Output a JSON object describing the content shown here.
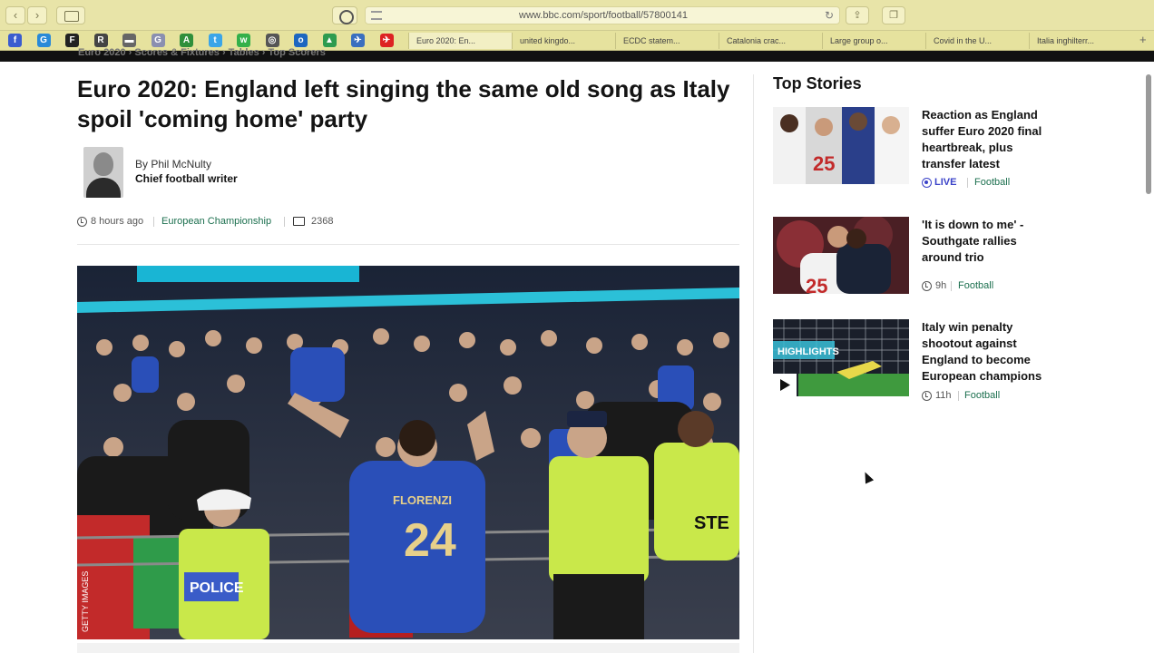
{
  "browser": {
    "url": "www.bbc.com/sport/football/57800141",
    "back_label": "‹",
    "forward_label": "›",
    "bookmarks": [
      {
        "name": "facebook",
        "glyph": "f",
        "color": "#3b5ccf"
      },
      {
        "name": "g",
        "glyph": "G",
        "color": "#2a8ad8"
      },
      {
        "name": "f-bold",
        "glyph": "F",
        "color": "#222222"
      },
      {
        "name": "r",
        "glyph": "R",
        "color": "#444444"
      },
      {
        "name": "bar",
        "glyph": "▬",
        "color": "#666666"
      },
      {
        "name": "g2",
        "glyph": "G",
        "color": "#8a8fb0"
      },
      {
        "name": "a",
        "glyph": "A",
        "color": "#2f8f3b"
      },
      {
        "name": "twitter",
        "glyph": "t",
        "color": "#3ba5e8"
      },
      {
        "name": "whatsapp",
        "glyph": "w",
        "color": "#34b04a"
      },
      {
        "name": "instagram",
        "glyph": "◎",
        "color": "#555555"
      },
      {
        "name": "outlook",
        "glyph": "o",
        "color": "#1c66c0"
      },
      {
        "name": "drive",
        "glyph": "▲",
        "color": "#2e9b4f"
      },
      {
        "name": "arrow",
        "glyph": "✈",
        "color": "#3a6fbf"
      },
      {
        "name": "red-arrow",
        "glyph": "✈",
        "color": "#d22"
      }
    ],
    "tabs": [
      {
        "label": "Euro 2020: En...",
        "active": true
      },
      {
        "label": "united kingdo...",
        "active": false
      },
      {
        "label": "ECDC statem...",
        "active": false
      },
      {
        "label": "Catalonia crac...",
        "active": false
      },
      {
        "label": "Large group o...",
        "active": false
      },
      {
        "label": "Covid in the U...",
        "active": false
      },
      {
        "label": "Italia inghilterr...",
        "active": false
      }
    ],
    "new_tab_label": "+"
  },
  "site_nav": {
    "partial_text": "Euro 2020 › Scores & Fixtures › Tables › Top Scorers"
  },
  "article": {
    "title": "Euro 2020: England left singing the same old song as Italy spoil 'coming home' party",
    "byline": "By Phil McNulty",
    "author_role": "Chief football writer",
    "time_ago": "8 hours ago",
    "topic": "European Championship",
    "comments": "2368",
    "hero_credit": "GETTY IMAGES",
    "hero_signs": {
      "police": "POLICE",
      "shirt_name": "FLORENZI",
      "shirt_number": "24",
      "steward": "STE"
    }
  },
  "top_stories": {
    "heading": "Top Stories",
    "items": [
      {
        "title": "Reaction as England suffer Euro 2020 final heartbreak, plus transfer latest",
        "status": "LIVE",
        "category": "Football",
        "thumb_number": "25"
      },
      {
        "title": "'It is down to me' - Southgate rallies around trio",
        "time": "9h",
        "category": "Football",
        "thumb_number": "25"
      },
      {
        "title": "Italy win penalty shootout against England to become European champions",
        "time": "11h",
        "category": "Football",
        "thumb_label": "HIGHLIGHTS"
      }
    ]
  },
  "colors": {
    "link": "#1b6f4e",
    "live": "#3a42c8",
    "italy_blue": "#2a4fb8",
    "hi_vis": "#c9e84a"
  }
}
